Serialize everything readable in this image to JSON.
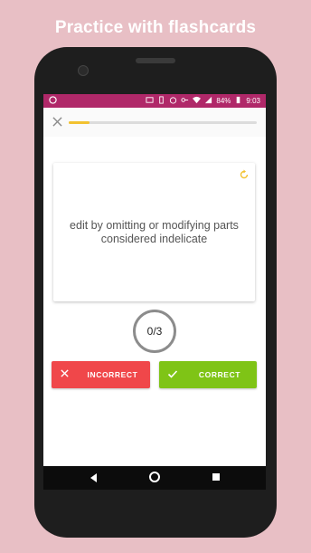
{
  "headline": "Practice with flashcards",
  "status_bar": {
    "battery": "84%",
    "time": "9:03",
    "bar_color": "#b02869"
  },
  "progress": {
    "fraction": 0.11,
    "fill_color": "#f2c230"
  },
  "card": {
    "text": "edit by omitting or modifying parts considered indelicate"
  },
  "counter": {
    "text": "0/3"
  },
  "buttons": {
    "incorrect": {
      "label": "INCORRECT",
      "color": "#f0474a",
      "icon": "x-icon"
    },
    "correct": {
      "label": "CORRECT",
      "color": "#7fc416",
      "icon": "check-icon"
    }
  },
  "nav": {
    "back_icon": "back-icon",
    "home_icon": "home-icon",
    "recents_icon": "recents-icon"
  }
}
